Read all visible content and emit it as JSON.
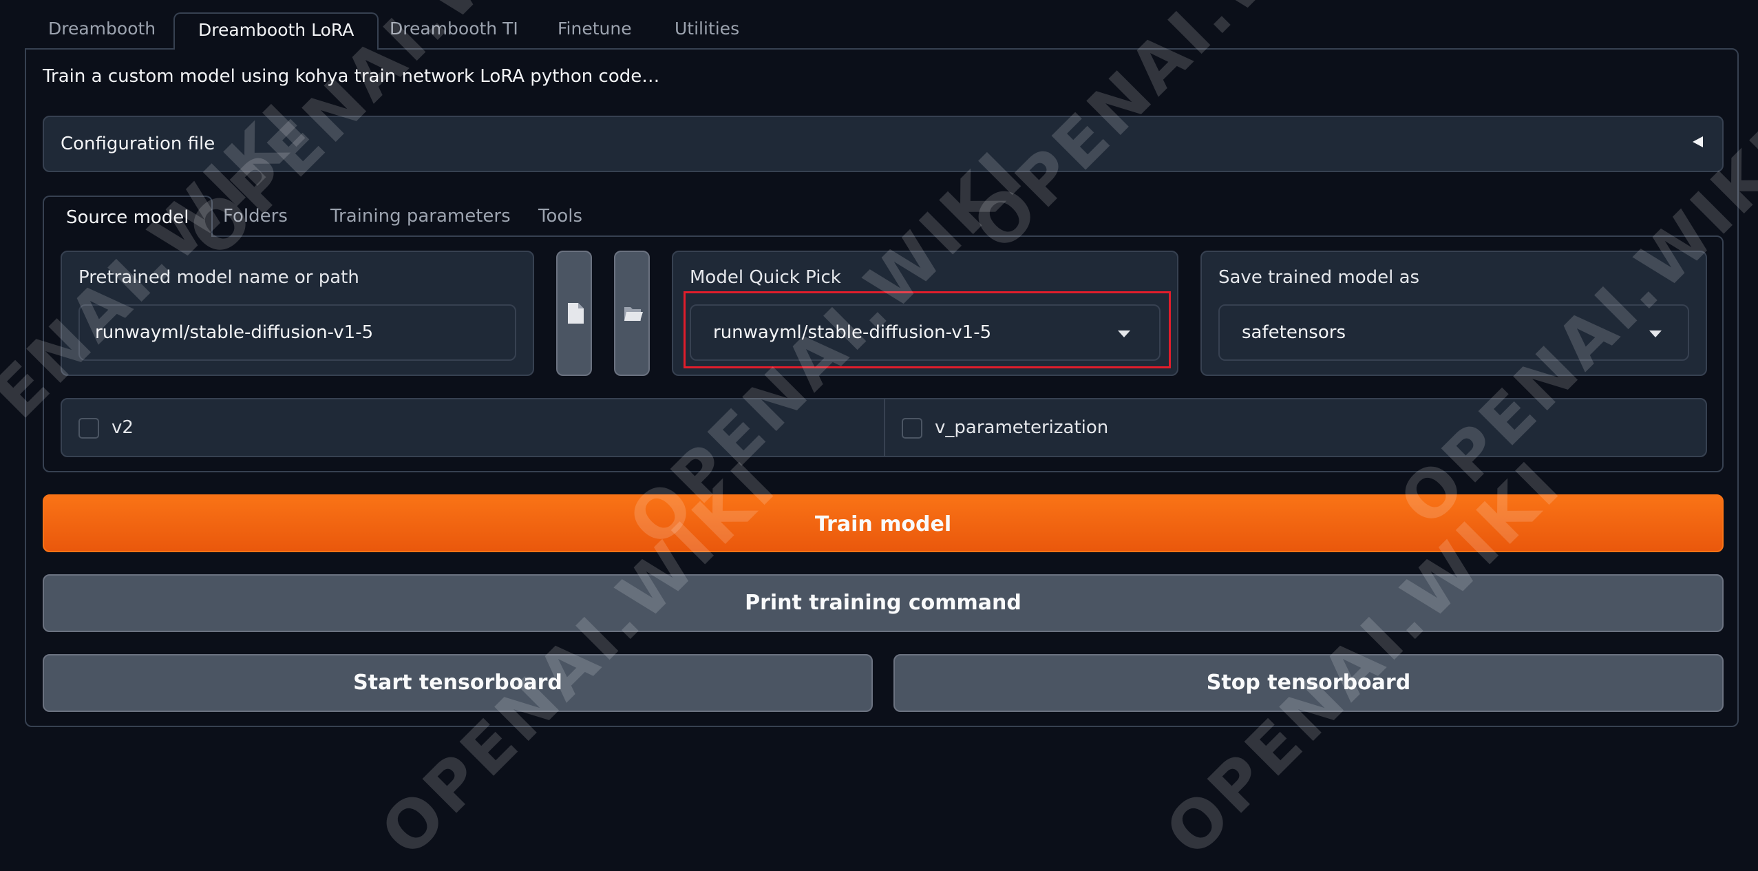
{
  "top_tabs": [
    {
      "label": "Dreambooth"
    },
    {
      "label": "Dreambooth LoRA"
    },
    {
      "label": "Dreambooth TI"
    },
    {
      "label": "Finetune"
    },
    {
      "label": "Utilities"
    }
  ],
  "description": "Train a custom model using kohya train network LoRA python code…",
  "config_accordion": {
    "label": "Configuration file",
    "icon": "triangle-left-icon"
  },
  "sub_tabs": [
    {
      "label": "Source model"
    },
    {
      "label": "Folders"
    },
    {
      "label": "Training parameters"
    },
    {
      "label": "Tools"
    }
  ],
  "pretrained": {
    "label": "Pretrained model name or path",
    "value": "runwayml/stable-diffusion-v1-5"
  },
  "icon_buttons": [
    {
      "icon": "file-icon"
    },
    {
      "icon": "folder-open-icon"
    }
  ],
  "model_quick_pick": {
    "label": "Model Quick Pick",
    "selected": "runwayml/stable-diffusion-v1-5"
  },
  "save_as": {
    "label": "Save trained model as",
    "selected": "safetensors"
  },
  "checkboxes": [
    {
      "label": "v2",
      "checked": false
    },
    {
      "label": "v_parameterization",
      "checked": false
    }
  ],
  "buttons": {
    "train": "Train model",
    "print_cmd": "Print training command",
    "start_tb": "Start tensorboard",
    "stop_tb": "Stop tensorboard"
  },
  "watermark": "OPENAI.WIKI",
  "colors": {
    "background": "#0b0f19",
    "panel": "#1f2937",
    "border": "#374151",
    "primary": "#f97316",
    "secondary": "#4b5563",
    "highlight": "#e11d2b"
  }
}
